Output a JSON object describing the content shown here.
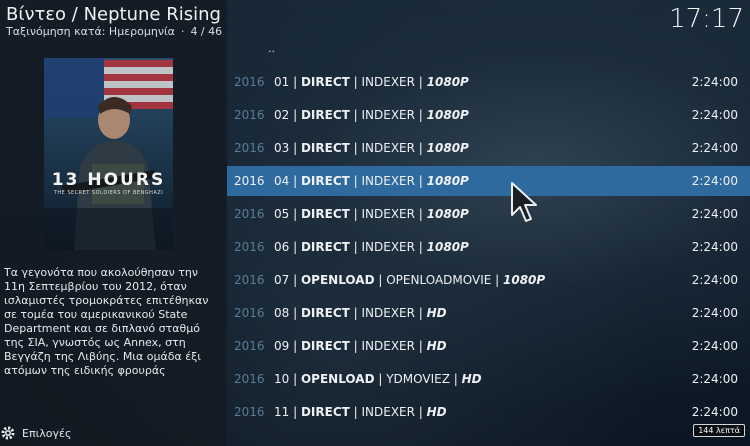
{
  "header": {
    "title": "Βίντεο /  Neptune Rising",
    "sort_label": "Ταξινόμηση κατά: Ημερομηνία",
    "position": "4 / 46",
    "clock": "17:17"
  },
  "poster": {
    "title_line1": "13 HOURS",
    "title_line2": "THE SECRET SOLDIERS OF BENGHAZI"
  },
  "plot": "Τα γεγονότα που ακολούθησαν την 11η Σεπτεμβρίου του 2012, όταν ισλαμιστές τρομοκράτες επιτέθηκαν σε τομέα του αμερικανικού State Department και σε διπλανό σταθμό της ΣΙΑ, γνωστός ως Annex, στη Βεγγάζη της Λιβύης. Μια ομάδα έξι ατόμων της ειδικής φρουράς",
  "options_label": "Επιλογές",
  "parent_item": "..",
  "rows": [
    {
      "year": "2016",
      "num": "01",
      "host": "DIRECT",
      "source": "INDEXER",
      "quality": "1080P",
      "duration": "2:24:00"
    },
    {
      "year": "2016",
      "num": "02",
      "host": "DIRECT",
      "source": "INDEXER",
      "quality": "1080P",
      "duration": "2:24:00"
    },
    {
      "year": "2016",
      "num": "03",
      "host": "DIRECT",
      "source": "INDEXER",
      "quality": "1080P",
      "duration": "2:24:00"
    },
    {
      "year": "2016",
      "num": "04",
      "host": "DIRECT",
      "source": "INDEXER",
      "quality": "1080P",
      "duration": "2:24:00"
    },
    {
      "year": "2016",
      "num": "05",
      "host": "DIRECT",
      "source": "INDEXER",
      "quality": "1080P",
      "duration": "2:24:00"
    },
    {
      "year": "2016",
      "num": "06",
      "host": "DIRECT",
      "source": "INDEXER",
      "quality": "1080P",
      "duration": "2:24:00"
    },
    {
      "year": "2016",
      "num": "07",
      "host": "OPENLOAD",
      "source": "OPENLOADMOVIE",
      "quality": "1080P",
      "duration": "2:24:00"
    },
    {
      "year": "2016",
      "num": "08",
      "host": "DIRECT",
      "source": "INDEXER",
      "quality": "HD",
      "duration": "2:24:00"
    },
    {
      "year": "2016",
      "num": "09",
      "host": "DIRECT",
      "source": "INDEXER",
      "quality": "HD",
      "duration": "2:24:00"
    },
    {
      "year": "2016",
      "num": "10",
      "host": "OPENLOAD",
      "source": "YDMOVIEZ",
      "quality": "HD",
      "duration": "2:24:00"
    },
    {
      "year": "2016",
      "num": "11",
      "host": "DIRECT",
      "source": "INDEXER",
      "quality": "HD",
      "duration": "2:24:00"
    }
  ],
  "selected_index": 3,
  "runtime_badge": "144 λεπτά",
  "colors": {
    "selected_row": "#2f6a9e",
    "year_dim": "#5b7b95"
  }
}
